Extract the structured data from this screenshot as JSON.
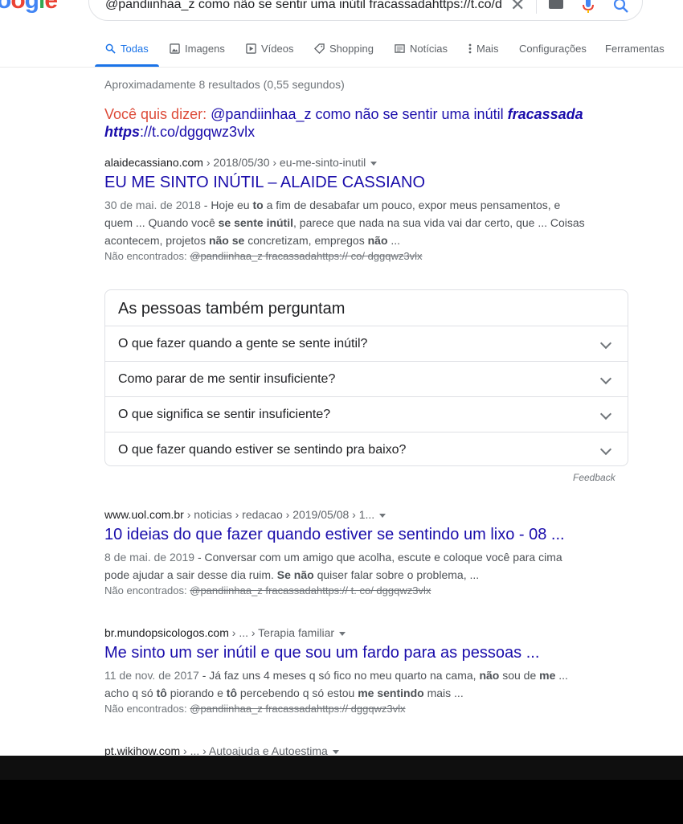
{
  "logo_partial": "oogle",
  "search": {
    "query": "@pandiinhaa_z como não se sentir uma inútil fracassadahttps://t.co/d"
  },
  "tabs": [
    {
      "label": "Todas",
      "icon": "search-icon"
    },
    {
      "label": "Imagens",
      "icon": "image-icon"
    },
    {
      "label": "Vídeos",
      "icon": "video-icon"
    },
    {
      "label": "Shopping",
      "icon": "tag-icon"
    },
    {
      "label": "Notícias",
      "icon": "news-icon"
    },
    {
      "label": "Mais",
      "icon": "more-vert-icon"
    },
    {
      "label": "Configurações"
    },
    {
      "label": "Ferramentas"
    }
  ],
  "stats": "Aproximadamente 8 resultados (0,55 segundos)",
  "did_you_mean": {
    "label": "Você quis dizer:",
    "text_before": "@pandiinhaa_z como não se sentir uma inútil",
    "bold1": "fracassada",
    "bold2": "https",
    "text_after": "://t.co/dggqwz3vlx"
  },
  "results": [
    {
      "domain": "alaidecassiano.com",
      "path": " › 2018/05/30 › eu-me-sinto-inutil",
      "title": "EU ME SINTO INÚTIL – ALAIDE CASSIANO",
      "date": "30 de mai. de 2018",
      "snippet_parts": [
        " - Hoje eu ",
        "to",
        " a fim de desabafar um pouco, expor meus pensamentos, e quem ... Quando você ",
        "se sente inútil",
        ", parece que nada na sua vida vai dar certo, que ... Coisas acontecem, projetos ",
        "não se",
        " concretizam, empregos ",
        "não",
        " ..."
      ],
      "nf_label": "Não encontrados:",
      "nf_terms": "@pandiinhaa_z fracassadahttps:// co/ dggqwz3vlx"
    },
    {
      "domain": "www.uol.com.br",
      "path": " › noticias › redacao › 2019/05/08 › 1...",
      "title": "10 ideias do que fazer quando estiver se sentindo um lixo - 08 ...",
      "date": "8 de mai. de 2019",
      "snippet_parts": [
        " - Conversar com um amigo que acolha, escute e coloque você para cima pode ajudar a sair desse dia ruim. ",
        "Se não",
        " quiser falar sobre o problema, ..."
      ],
      "nf_label": "Não encontrados:",
      "nf_terms": "@pandiinhaa_z fracassadahttps:// t. co/ dggqwz3vlx"
    },
    {
      "domain": "br.mundopsicologos.com",
      "path": " › ... › Terapia familiar",
      "title": "Me sinto um ser inútil e que sou um fardo para as pessoas ...",
      "date": "11 de nov. de 2017",
      "snippet_parts": [
        " - Já faz uns 4 meses q só fico no meu quarto na cama, ",
        "não",
        " sou de ",
        "me",
        " ... acho q só ",
        "tô",
        " piorando e ",
        "tô",
        " percebendo q só estou ",
        "me sentindo",
        " mais ..."
      ],
      "nf_label": "Não encontrados:",
      "nf_terms": "@pandiinhaa_z fracassadahttps:// dggqwz3vlx"
    },
    {
      "domain": "pt.wikihow.com",
      "path": " › ... › Autoajuda e Autoestima"
    }
  ],
  "paa": {
    "title": "As pessoas também perguntam",
    "questions": [
      "O que fazer quando a gente se sente inútil?",
      "Como parar de me sentir insuficiente?",
      "O que significa se sentir insuficiente?",
      "O que fazer quando estiver se sentindo pra baixo?"
    ]
  },
  "feedback": "Feedback",
  "colors": {
    "link": "#1a0dab",
    "accent": "#1a73e8",
    "dym_label": "#dd4b39"
  }
}
